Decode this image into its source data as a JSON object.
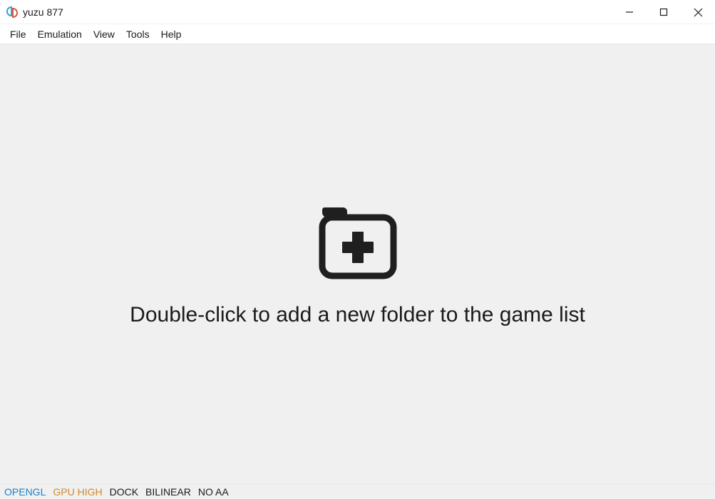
{
  "window": {
    "title": "yuzu 877"
  },
  "menubar": {
    "items": [
      "File",
      "Emulation",
      "View",
      "Tools",
      "Help"
    ]
  },
  "main": {
    "placeholder_text": "Double-click to add a new folder to the game list"
  },
  "statusbar": {
    "opengl": "OPENGL",
    "gpu": "GPU HIGH",
    "dock": "DOCK",
    "filter": "BILINEAR",
    "aa": "NO AA"
  }
}
